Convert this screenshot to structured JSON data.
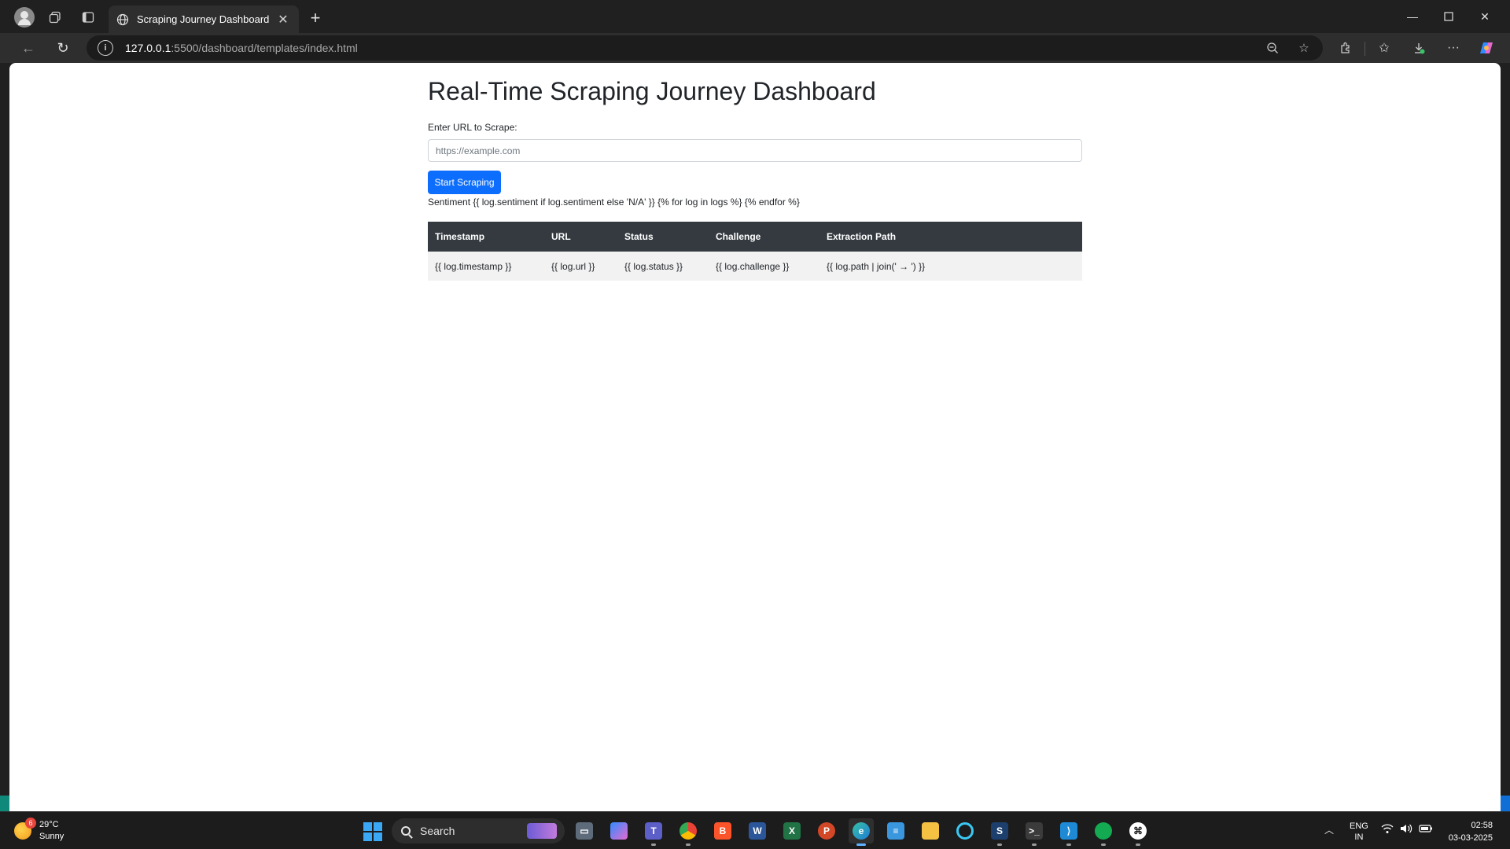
{
  "browser": {
    "tab_title": "Scraping Journey Dashboard",
    "url_host": "127.0.0.1",
    "url_path": ":5500/dashboard/templates/index.html"
  },
  "page": {
    "title": "Real-Time Scraping Journey Dashboard",
    "url_label": "Enter URL to Scrape:",
    "url_placeholder": "https://example.com",
    "url_value": "",
    "start_button": "Start Scraping",
    "sentiment_text": "Sentiment {{ log.sentiment if log.sentiment else 'N/A' }} {% for log in logs %} {% endfor %}"
  },
  "table": {
    "headers": [
      "Timestamp",
      "URL",
      "Status",
      "Challenge",
      "Extraction Path"
    ],
    "rows": [
      [
        "{{ log.timestamp }}",
        "{{ log.url }}",
        "{{ log.status }}",
        "{{ log.challenge }}",
        "{{ log.path | join(' → ') }}"
      ]
    ]
  },
  "taskbar": {
    "weather_temp": "29°C",
    "weather_desc": "Sunny",
    "weather_badge": "6",
    "search_label": "Search",
    "lang_line1": "ENG",
    "lang_line2": "IN",
    "time": "02:58",
    "date": "03-03-2025"
  },
  "colors": {
    "accent": "#0d6efd",
    "table_header": "#343a40",
    "row_background": "#f2f2f2"
  }
}
